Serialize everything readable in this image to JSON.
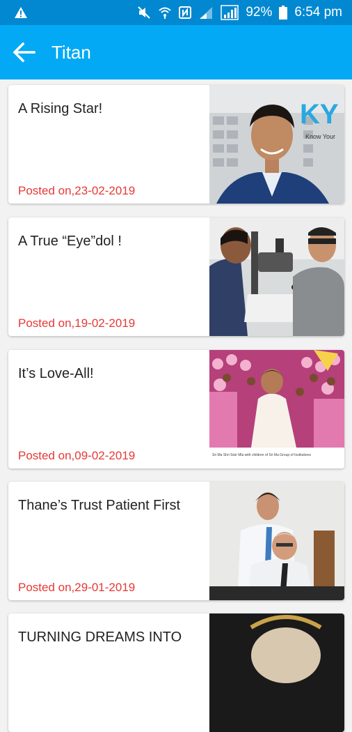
{
  "status_bar": {
    "battery": "92%",
    "time": "6:54 pm"
  },
  "app_bar": {
    "title": "Titan"
  },
  "articles": [
    {
      "title": "A Rising Star!",
      "posted": "Posted on,23-02-2019",
      "image_text": "KY",
      "image_subtext": "Know Your"
    },
    {
      "title": "A True “Eye”dol !",
      "posted": "Posted on,19-02-2019"
    },
    {
      "title": "It’s Love-All!",
      "posted": "Posted on,09-02-2019"
    },
    {
      "title": "Thane’s Trust Patient First",
      "posted": "Posted on,29-01-2019"
    },
    {
      "title": "TURNING DREAMS INTO"
    }
  ],
  "colors": {
    "status_bar": "#0288d1",
    "app_bar": "#03a9f4",
    "posted_text": "#e53935"
  }
}
